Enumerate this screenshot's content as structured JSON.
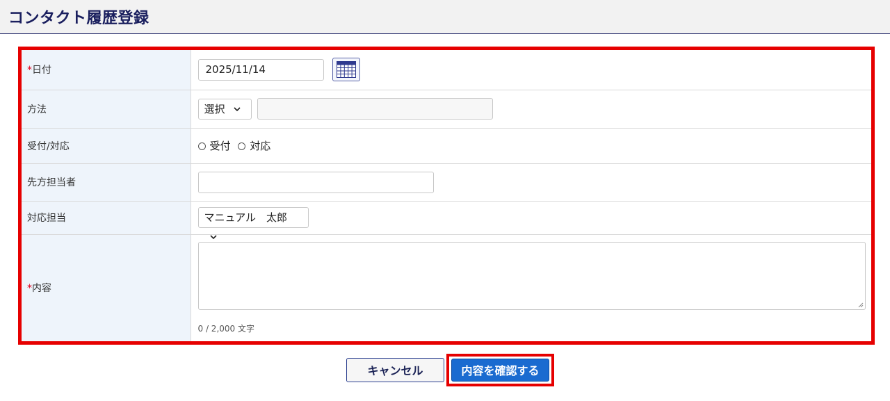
{
  "header": {
    "title": "コンタクト履歴登録"
  },
  "form": {
    "required_mark": "*",
    "date": {
      "label": "日付",
      "value": "2025/11/14"
    },
    "method": {
      "label": "方法",
      "select_value": "選択",
      "text_value": ""
    },
    "direction": {
      "label": "受付/対応",
      "options": [
        "受付",
        "対応"
      ]
    },
    "partner": {
      "label": "先方担当者",
      "value": ""
    },
    "staff": {
      "label": "対応担当",
      "value": "マニュアル　太郎"
    },
    "content": {
      "label": "内容",
      "value": "",
      "counter": "0 / 2,000 文字"
    }
  },
  "actions": {
    "cancel_label": "キャンセル",
    "confirm_label": "内容を確認する"
  },
  "colors": {
    "highlight": "#e60000",
    "primary": "#1a6bd0",
    "label_bg": "#eef4fb",
    "title": "#1a1f5e"
  }
}
